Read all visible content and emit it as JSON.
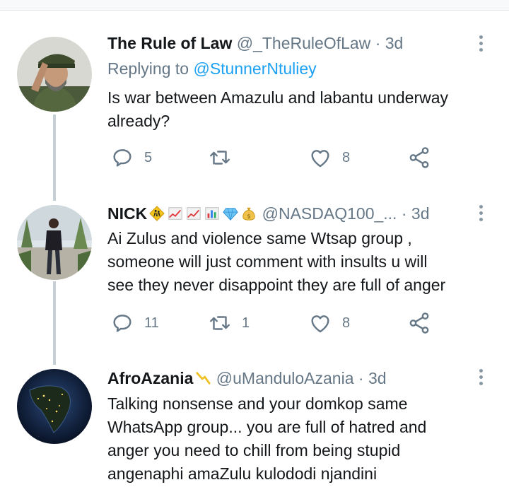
{
  "tweets": [
    {
      "name": "The Rule of Law",
      "handle": "@_TheRuleOfLaw",
      "sep": "·",
      "time": "3d",
      "replying_prefix": "Replying to",
      "replying_to": "@StunnerNtuliey",
      "text_lines": [
        "Is war between Amazulu and labantu underway",
        "already?"
      ],
      "replies": "5",
      "retweets": "",
      "likes": "8"
    },
    {
      "name": "NICK",
      "name_emoji": [
        "children-crossing",
        "chart-increasing",
        "chart-increasing",
        "bar-chart",
        "gem",
        "money-bag"
      ],
      "handle": "@NASDAQ100_...",
      "sep": "·",
      "time": "3d",
      "text_lines": [
        "Ai Zulus and violence same Wtsap group ,",
        "someone will just comment with insults u will",
        "see they never disappoint they are full of anger"
      ],
      "replies": "11",
      "retweets": "1",
      "likes": "8"
    },
    {
      "name": "AfroAzania",
      "name_emoji": [
        "chart-decreasing"
      ],
      "handle": "@uMandulоAzania",
      "sep": "·",
      "time": "3d",
      "text_lines": [
        "Talking nonsense and your domkop same",
        "WhatsApp group... you are full of hatred and",
        "anger you need to chill from being stupid",
        "angenaphi amaZulu kulododi njandini"
      ]
    }
  ],
  "colors": {
    "link": "#1da1f2",
    "muted": "#657786",
    "thread": "#c4cfd6"
  },
  "icons": {
    "reply": "reply-icon",
    "retweet": "retweet-icon",
    "like": "heart-icon",
    "share": "share-icon",
    "more": "more-vertical-icon"
  }
}
